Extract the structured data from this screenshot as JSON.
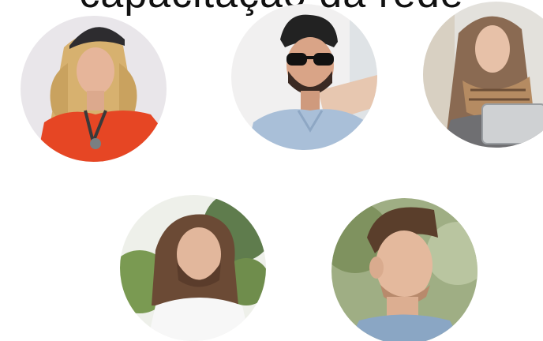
{
  "header": {
    "title": "capacitação da rede"
  },
  "profiles": [
    {
      "photo": "woman-blonde-cap-portrait"
    },
    {
      "photo": "man-sunglasses-portrait"
    },
    {
      "photo": "woman-scarf-tablet-portrait"
    },
    {
      "photo": "man-long-hair-beard-portrait"
    },
    {
      "photo": "man-short-hair-portrait"
    }
  ]
}
